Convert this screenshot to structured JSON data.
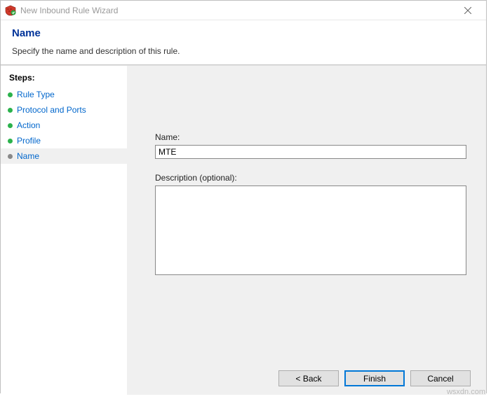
{
  "window": {
    "title": "New Inbound Rule Wizard"
  },
  "header": {
    "title": "Name",
    "subtitle": "Specify the name and description of this rule."
  },
  "sidebar": {
    "steps_label": "Steps:",
    "items": [
      {
        "label": "Rule Type"
      },
      {
        "label": "Protocol and Ports"
      },
      {
        "label": "Action"
      },
      {
        "label": "Profile"
      },
      {
        "label": "Name"
      }
    ]
  },
  "form": {
    "name_label": "Name:",
    "name_value": "MTE",
    "desc_label": "Description (optional):",
    "desc_value": ""
  },
  "buttons": {
    "back": "< Back",
    "finish": "Finish",
    "cancel": "Cancel"
  },
  "watermark": "wsxdn.com"
}
